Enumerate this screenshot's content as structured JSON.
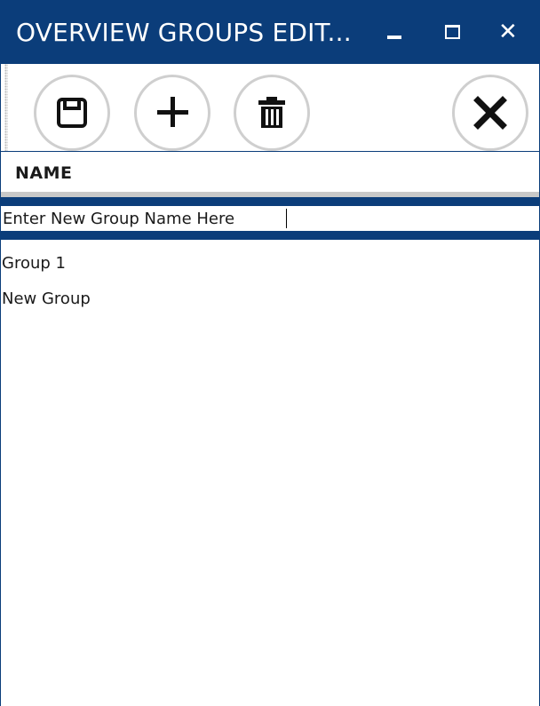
{
  "window": {
    "title": "OVERVIEW GROUPS EDIT...",
    "minimize_icon": "minimize-icon",
    "maximize_icon": "maximize-icon",
    "close_icon": "close-icon",
    "close_glyph": "✕"
  },
  "toolbar": {
    "buttons": [
      {
        "name": "save",
        "icon": "floppy-disk-icon"
      },
      {
        "name": "add",
        "icon": "plus-icon"
      },
      {
        "name": "delete",
        "icon": "trash-icon"
      },
      {
        "name": "close",
        "icon": "close-icon"
      }
    ]
  },
  "grid": {
    "header": "NAME",
    "edit_value": "Enter New Group Name Here",
    "rows": [
      "Group 1",
      "New Group"
    ]
  },
  "colors": {
    "accent": "#0b3d7a",
    "button_border": "#cfcfcf",
    "header_rule": "#c8c8c8"
  }
}
